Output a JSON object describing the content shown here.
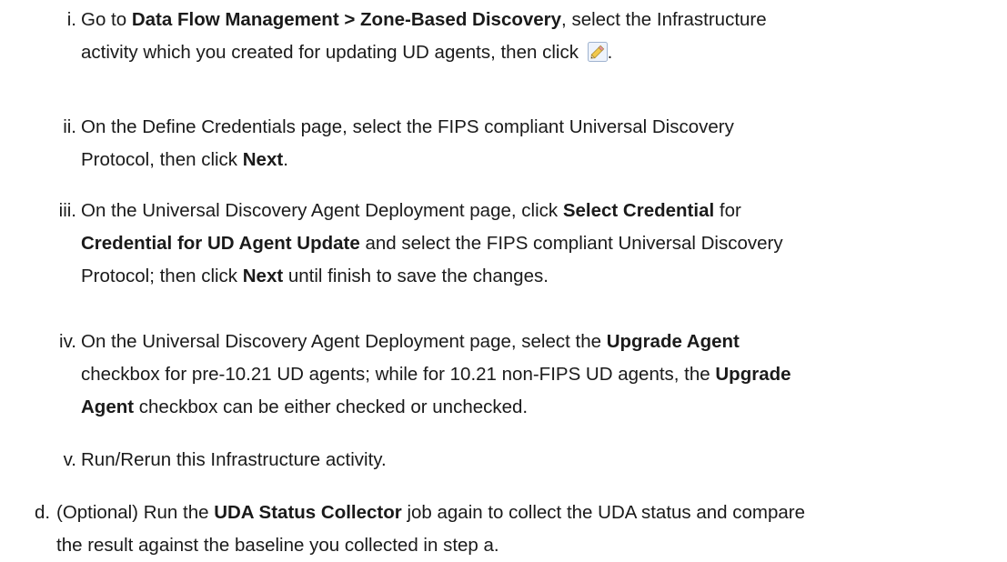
{
  "steps": [
    {
      "marker": "i.",
      "lines": [
        [
          {
            "text": "Go to ",
            "bold": false
          },
          {
            "text": "Data Flow Management > Zone-Based Discovery",
            "bold": true
          },
          {
            "text": ", select the Infrastructure",
            "bold": false
          }
        ],
        [
          {
            "text": "activity which you created for updating UD agents, then click ",
            "bold": false
          },
          {
            "icon": "pencil-edit-icon"
          },
          {
            "text": ".",
            "bold": false
          }
        ]
      ]
    },
    {
      "marker": "ii.",
      "lines": [
        [
          {
            "text": "On the Define Credentials page, select the FIPS compliant Universal Discovery",
            "bold": false
          }
        ],
        [
          {
            "text": "Protocol, then click ",
            "bold": false
          },
          {
            "text": "Next",
            "bold": true
          },
          {
            "text": ".",
            "bold": false
          }
        ]
      ]
    },
    {
      "marker": "iii.",
      "lines": [
        [
          {
            "text": "On the Universal Discovery Agent Deployment page, click ",
            "bold": false
          },
          {
            "text": "Select Credential",
            "bold": true
          },
          {
            "text": " for",
            "bold": false
          }
        ],
        [
          {
            "text": "Credential for UD Agent Update",
            "bold": true
          },
          {
            "text": " and select the FIPS compliant Universal Discovery",
            "bold": false
          }
        ],
        [
          {
            "text": "Protocol; then click ",
            "bold": false
          },
          {
            "text": "Next",
            "bold": true
          },
          {
            "text": " until finish to save the changes.",
            "bold": false
          }
        ]
      ]
    },
    {
      "marker": "iv.",
      "lines": [
        [
          {
            "text": "On the Universal Discovery Agent Deployment page, select the ",
            "bold": false
          },
          {
            "text": "Upgrade Agent",
            "bold": true
          }
        ],
        [
          {
            "text": "checkbox for pre-10.21 UD agents; while for 10.21 non-FIPS UD agents, the ",
            "bold": false
          },
          {
            "text": "Upgrade",
            "bold": true
          }
        ],
        [
          {
            "text": "Agent",
            "bold": true
          },
          {
            "text": " checkbox can be either checked or unchecked.",
            "bold": false
          }
        ]
      ]
    },
    {
      "marker": "v.",
      "lines": [
        [
          {
            "text": "Run/Rerun this Infrastructure activity.",
            "bold": false
          }
        ]
      ]
    }
  ],
  "outer_step": {
    "marker": "d.",
    "lines": [
      [
        {
          "text": "(Optional) Run the ",
          "bold": false
        },
        {
          "text": "UDA Status Collector",
          "bold": true
        },
        {
          "text": " job again to collect the UDA status and compare",
          "bold": false
        }
      ],
      [
        {
          "text": "the result against the baseline you collected in step a.",
          "bold": false
        }
      ]
    ]
  }
}
